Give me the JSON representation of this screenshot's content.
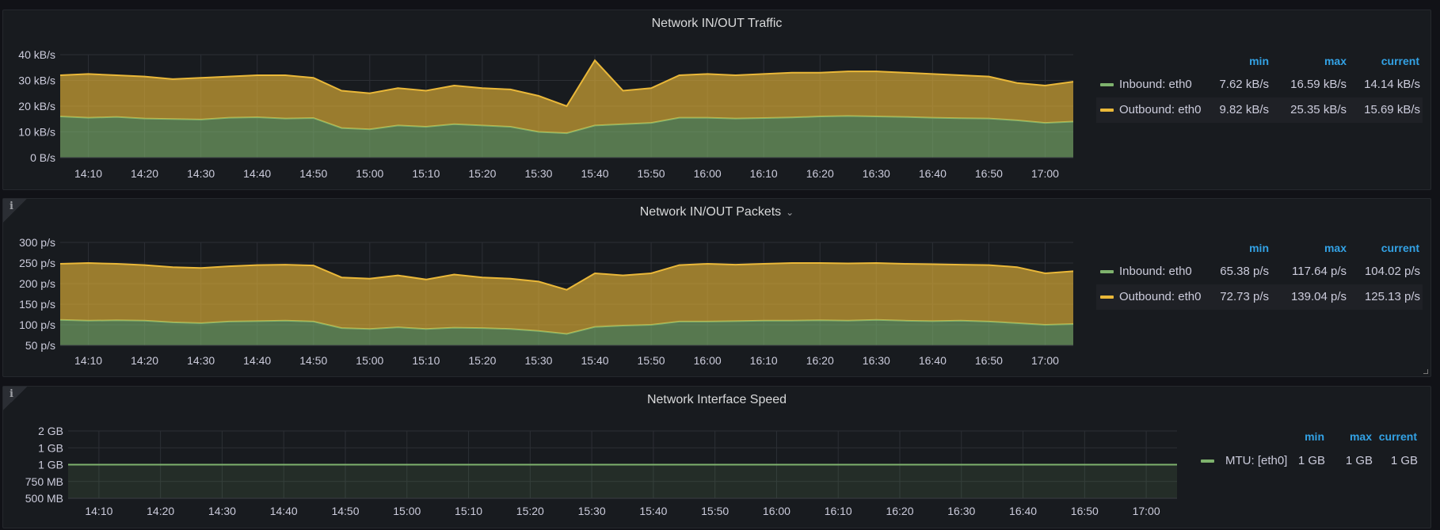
{
  "colors": {
    "inbound": "#7eb26d",
    "outbound": "#eab839",
    "accent": "#33a2e5"
  },
  "panels": [
    {
      "title": "Network IN/OUT Traffic",
      "has_info": false,
      "has_menu_chevron": false,
      "legend": {
        "headers": [
          "min",
          "max",
          "current"
        ],
        "rows": [
          {
            "name": "Inbound: eth0",
            "color": "#7eb26d",
            "min": "7.62 kB/s",
            "max": "16.59 kB/s",
            "current": "14.14 kB/s"
          },
          {
            "name": "Outbound: eth0",
            "color": "#eab839",
            "min": "9.82 kB/s",
            "max": "25.35 kB/s",
            "current": "15.69 kB/s"
          }
        ]
      }
    },
    {
      "title": "Network IN/OUT Packets",
      "has_info": true,
      "info_icon": "i",
      "has_menu_chevron": true,
      "chevron": "⌄",
      "legend": {
        "headers": [
          "min",
          "max",
          "current"
        ],
        "rows": [
          {
            "name": "Inbound: eth0",
            "color": "#7eb26d",
            "min": "65.38 p/s",
            "max": "117.64 p/s",
            "current": "104.02 p/s"
          },
          {
            "name": "Outbound: eth0",
            "color": "#eab839",
            "min": "72.73 p/s",
            "max": "139.04 p/s",
            "current": "125.13 p/s"
          }
        ]
      }
    },
    {
      "title": "Network Interface Speed",
      "has_info": true,
      "info_icon": "i",
      "has_menu_chevron": false,
      "legend": {
        "headers": [
          "min",
          "max",
          "current"
        ],
        "rows": [
          {
            "name": "MTU: [eth0]",
            "color": "#7eb26d",
            "min": "1 GB",
            "max": "1 GB",
            "current": "1 GB"
          }
        ]
      }
    }
  ],
  "chart_data": [
    {
      "type": "area",
      "stacked": true,
      "title": "Network IN/OUT Traffic",
      "unit": "kB/s",
      "x_start": "14:05",
      "x_step_minutes": 5,
      "x_span_minutes": 180,
      "ylim": [
        0,
        40
      ],
      "yticks": [
        {
          "value": 0,
          "label": "0 B/s"
        },
        {
          "value": 10,
          "label": "10 kB/s"
        },
        {
          "value": 20,
          "label": "20 kB/s"
        },
        {
          "value": 30,
          "label": "30 kB/s"
        },
        {
          "value": 40,
          "label": "40 kB/s"
        }
      ],
      "xticks": [
        "14:10",
        "14:20",
        "14:30",
        "14:40",
        "14:50",
        "15:00",
        "15:10",
        "15:20",
        "15:30",
        "15:40",
        "15:50",
        "16:00",
        "16:10",
        "16:20",
        "16:30",
        "16:40",
        "16:50",
        "17:00"
      ],
      "series": [
        {
          "name": "Inbound: eth0",
          "color": "#7eb26d",
          "values": [
            16,
            15.5,
            15.8,
            15.2,
            15,
            14.8,
            15.5,
            15.7,
            15.2,
            15.4,
            11.5,
            11,
            12.5,
            12,
            13,
            12.5,
            12,
            10,
            9.5,
            12.5,
            13,
            13.5,
            15.5,
            15.5,
            15.2,
            15.4,
            15.6,
            16,
            16.2,
            16,
            15.8,
            15.5,
            15.3,
            15.2,
            14.5,
            13.5,
            14
          ]
        },
        {
          "name": "Outbound: eth0",
          "color": "#eab839",
          "values": [
            16,
            17,
            16.2,
            16.3,
            15.5,
            16.2,
            16,
            16.3,
            16.8,
            15.6,
            14.5,
            14,
            14.5,
            14,
            15,
            14.5,
            14.5,
            14,
            10.5,
            25.3,
            13,
            13.5,
            16.5,
            17,
            16.8,
            17.1,
            17.4,
            17,
            17.3,
            17.5,
            17.2,
            17,
            16.7,
            16.3,
            14.5,
            14.5,
            15.5
          ]
        }
      ]
    },
    {
      "type": "area",
      "stacked": true,
      "title": "Network IN/OUT Packets",
      "unit": "p/s",
      "x_start": "14:05",
      "x_step_minutes": 5,
      "x_span_minutes": 180,
      "ylim": [
        50,
        300
      ],
      "yticks": [
        {
          "value": 50,
          "label": "50 p/s"
        },
        {
          "value": 100,
          "label": "100 p/s"
        },
        {
          "value": 150,
          "label": "150 p/s"
        },
        {
          "value": 200,
          "label": "200 p/s"
        },
        {
          "value": 250,
          "label": "250 p/s"
        },
        {
          "value": 300,
          "label": "300 p/s"
        }
      ],
      "xticks": [
        "14:10",
        "14:20",
        "14:30",
        "14:40",
        "14:50",
        "15:00",
        "15:10",
        "15:20",
        "15:30",
        "15:40",
        "15:50",
        "16:00",
        "16:10",
        "16:20",
        "16:30",
        "16:40",
        "16:50",
        "17:00"
      ],
      "series": [
        {
          "name": "Inbound: eth0",
          "color": "#7eb26d",
          "values": [
            112,
            110,
            111,
            110,
            106,
            104,
            108,
            109,
            110,
            108,
            92,
            90,
            94,
            90,
            93,
            92,
            90,
            85,
            78,
            95,
            98,
            100,
            108,
            108,
            109,
            110,
            110,
            111,
            110,
            112,
            110,
            109,
            110,
            108,
            104,
            100,
            102
          ]
        },
        {
          "name": "Outbound: eth0",
          "color": "#eab839",
          "values": [
            136,
            140,
            137,
            135,
            134,
            134,
            134,
            136,
            136,
            136,
            123,
            122,
            126,
            120,
            129,
            123,
            122,
            120,
            107,
            130,
            122,
            125,
            137,
            140,
            137,
            138,
            140,
            139,
            139,
            138,
            138,
            138,
            136,
            137,
            136,
            125,
            128
          ]
        }
      ]
    },
    {
      "type": "area",
      "stacked": false,
      "title": "Network Interface Speed",
      "unit": "MB",
      "x_start": "14:05",
      "x_step_minutes": 5,
      "x_span_minutes": 180,
      "ylim": [
        500,
        1500
      ],
      "yticks": [
        {
          "value": 500,
          "label": "500 MB"
        },
        {
          "value": 750,
          "label": "750 MB"
        },
        {
          "value": 1000,
          "label": "1 GB"
        },
        {
          "value": 1250,
          "label": "1 GB"
        },
        {
          "value": 1500,
          "label": "2 GB"
        }
      ],
      "xticks": [
        "14:10",
        "14:20",
        "14:30",
        "14:40",
        "14:50",
        "15:00",
        "15:10",
        "15:20",
        "15:30",
        "15:40",
        "15:50",
        "16:00",
        "16:10",
        "16:20",
        "16:30",
        "16:40",
        "16:50",
        "17:00"
      ],
      "series": [
        {
          "name": "MTU: [eth0]",
          "color": "#7eb26d",
          "values": [
            1000,
            1000,
            1000,
            1000,
            1000,
            1000,
            1000,
            1000,
            1000,
            1000,
            1000,
            1000,
            1000,
            1000,
            1000,
            1000,
            1000,
            1000,
            1000,
            1000,
            1000,
            1000,
            1000,
            1000,
            1000,
            1000,
            1000,
            1000,
            1000,
            1000,
            1000,
            1000,
            1000,
            1000,
            1000,
            1000,
            1000
          ]
        }
      ]
    }
  ]
}
